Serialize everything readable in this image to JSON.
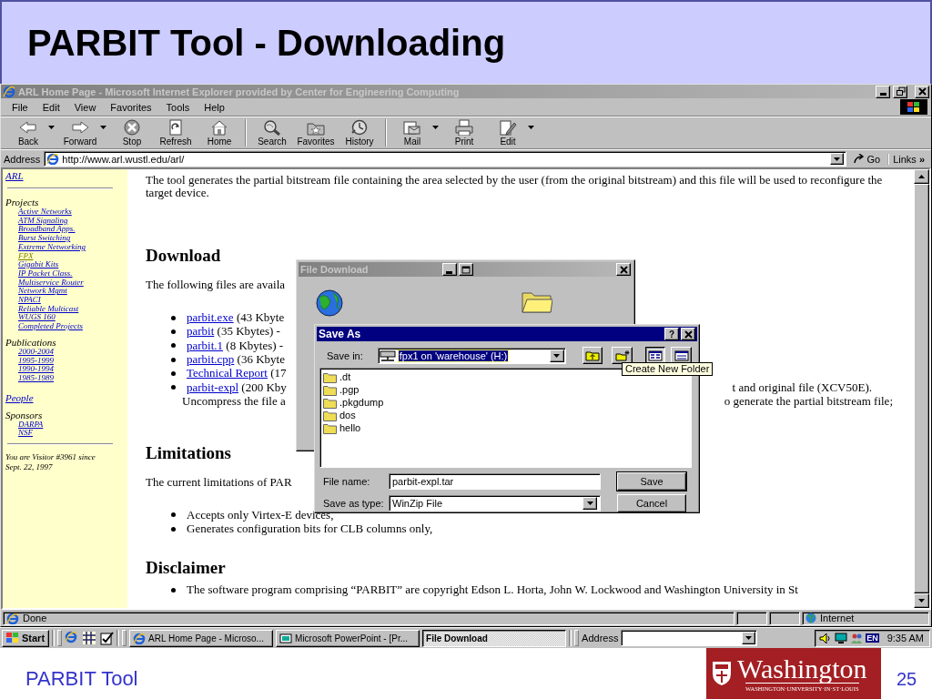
{
  "slide": {
    "title": "PARBIT Tool - Downloading",
    "footer": "PARBIT Tool",
    "page_number": "25",
    "logo": {
      "name": "Washington",
      "subtitle": "WASHINGTON·UNIVERSITY·IN·ST·LOUIS"
    }
  },
  "browser": {
    "title": "ARL Home Page - Microsoft Internet Explorer provided by Center for Engineering Computing",
    "menu": [
      "File",
      "Edit",
      "View",
      "Favorites",
      "Tools",
      "Help"
    ],
    "toolbar": [
      [
        {
          "label": "Back",
          "kind": "back",
          "dropdown": true
        },
        {
          "label": "Forward",
          "kind": "forward",
          "dropdown": true
        },
        {
          "label": "Stop",
          "kind": "stop",
          "dropdown": false
        },
        {
          "label": "Refresh",
          "kind": "refresh",
          "dropdown": false
        },
        {
          "label": "Home",
          "kind": "home",
          "dropdown": false
        }
      ],
      [
        {
          "label": "Search",
          "kind": "search",
          "dropdown": false
        },
        {
          "label": "Favorites",
          "kind": "favorites",
          "dropdown": false
        },
        {
          "label": "History",
          "kind": "history",
          "dropdown": false
        }
      ],
      [
        {
          "label": "Mail",
          "kind": "mail",
          "dropdown": true
        },
        {
          "label": "Print",
          "kind": "print",
          "dropdown": false
        },
        {
          "label": "Edit",
          "kind": "edit",
          "dropdown": true
        }
      ]
    ],
    "address": {
      "label": "Address",
      "value": "http://www.arl.wustl.edu/arl/",
      "go": "Go",
      "links": "Links",
      "more": "»"
    },
    "sidebar": [
      {
        "kind": "link",
        "label": "ARL"
      },
      {
        "kind": "rule"
      },
      {
        "kind": "heading",
        "label": "Projects",
        "links": [
          {
            "label": "Active Networks",
            "visited": false
          },
          {
            "label": "ATM Signaling",
            "visited": false
          },
          {
            "label": "Broadband Apps.",
            "visited": false
          },
          {
            "label": "Burst Switching",
            "visited": false
          },
          {
            "label": "Extreme Networking",
            "visited": false
          },
          {
            "label": "FPX",
            "visited": true
          },
          {
            "label": "Gigabit Kits",
            "visited": false
          },
          {
            "label": "IP Packet Class.",
            "visited": false
          },
          {
            "label": "Multiservice Router",
            "visited": false
          },
          {
            "label": "Network Mgmt",
            "visited": false
          },
          {
            "label": "NPACI",
            "visited": false
          },
          {
            "label": "Reliable Multicast",
            "visited": false
          },
          {
            "label": "WUGS 160",
            "visited": false
          },
          {
            "label": "Completed Projects",
            "visited": false
          }
        ]
      },
      {
        "kind": "heading",
        "label": "Publications",
        "links": [
          {
            "label": "2000-2004",
            "visited": false
          },
          {
            "label": "1995-1999",
            "visited": false
          },
          {
            "label": "1990-1994",
            "visited": false
          },
          {
            "label": "1985-1989",
            "visited": false
          }
        ]
      },
      {
        "kind": "link",
        "label": "People"
      },
      {
        "kind": "heading",
        "label": "Sponsors",
        "links": [
          {
            "label": "DARPA",
            "visited": false
          },
          {
            "label": "NSF",
            "visited": false
          }
        ]
      },
      {
        "kind": "rule"
      },
      {
        "kind": "note",
        "label": "You are Visitor #3961 since Sept. 22, 1997"
      }
    ],
    "content": [
      {
        "kind": "paragraph",
        "text": "The tool generates the partial bitstream file containing the area selected by the user (from the original bitstream) and this file will be used to reconfigure the target device."
      },
      {
        "kind": "heading",
        "text": "Download"
      },
      {
        "kind": "paragraph",
        "text": "The following files are availa"
      },
      {
        "kind": "list",
        "items": [
          {
            "link": "parbit.exe",
            "text": " (43 Kbyte"
          },
          {
            "link": "parbit",
            "text": " (35 Kbytes) -"
          },
          {
            "link": "parbit.1",
            "text": " (8 Kbytes) -"
          },
          {
            "link": "parbit.cpp",
            "text": " (36 Kbyte"
          },
          {
            "link": "Technical Report",
            "text": " (17"
          },
          {
            "link": "parbit-expl",
            "text": " (200 Kby",
            "tail": "t and original file (XCV50E).",
            "continuation": "Uncompress the file a",
            "continuation_tail": "o generate the partial bitstream file;"
          }
        ]
      },
      {
        "kind": "heading",
        "text": "Limitations"
      },
      {
        "kind": "paragraph",
        "text": "The current limitations of PAR"
      },
      {
        "kind": "list",
        "items": [
          {
            "text": "Accepts only Virtex-E devices,"
          },
          {
            "text": "Generates configuration bits for CLB columns only,"
          }
        ]
      },
      {
        "kind": "heading",
        "text": "Disclaimer"
      },
      {
        "kind": "list",
        "items": [
          {
            "text": "The software program comprising “PARBIT” are copyright Edson L. Horta, John W. Lockwood and Washington University in St"
          }
        ]
      }
    ],
    "status_bar": {
      "text": "Done",
      "zone": "Internet"
    }
  },
  "taskbar": {
    "start": "Start",
    "buttons": [
      {
        "label": "ARL Home Page - Microso...",
        "selected": false
      },
      {
        "label": "Microsoft PowerPoint - [Pr...",
        "selected": false
      },
      {
        "label": "File Download",
        "selected": true
      }
    ],
    "address": "Address",
    "language": "EN",
    "clock": "9:35 AM"
  },
  "file_download": {
    "title": "File Download"
  },
  "save_as": {
    "title": "Save As",
    "help": "?",
    "save_in_label": "Save in:",
    "location": "fpx1 on 'warehouse' (H:)",
    "view_buttons": [
      {
        "kind": "list",
        "selected": true
      },
      {
        "kind": "details",
        "selected": false
      }
    ],
    "tooltip": "Create New Folder",
    "files": [
      ".dt",
      ".pgp",
      ".pkgdump",
      "dos",
      "hello"
    ],
    "file_name_label": "File name:",
    "file_name": "parbit-expl.tar",
    "type_label": "Save as type:",
    "type": "WinZip File",
    "buttons": [
      {
        "label": "Save",
        "kind": "default"
      },
      {
        "label": "Cancel",
        "kind": "normal"
      }
    ]
  }
}
